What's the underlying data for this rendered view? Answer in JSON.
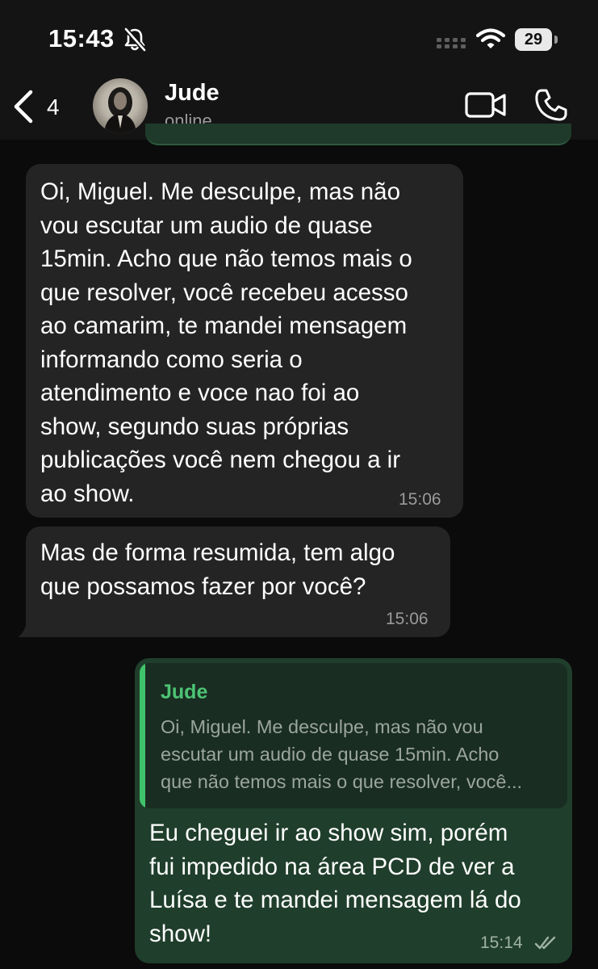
{
  "status_bar": {
    "time": "15:43",
    "battery": "29",
    "icons": [
      "bell-slash-icon",
      "signal-icon",
      "wifi-icon",
      "battery-icon"
    ]
  },
  "header": {
    "back_count": "4",
    "contact_name": "Jude",
    "contact_status": "online",
    "icons": [
      "chevron-left-icon",
      "video-camera-icon",
      "phone-icon"
    ]
  },
  "messages": [
    {
      "direction": "incoming",
      "text": "Oi, Miguel. Me desculpe, mas não\nvou escutar um audio de quase\n15min. Acho que não temos mais o\nque resolver, você recebeu acesso\nao camarim, te mandei mensagem\ninformando como seria o\natendimento e voce nao foi ao\nshow, segundo suas próprias\npublicações você nem chegou a ir\nao show.",
      "time": "15:06"
    },
    {
      "direction": "incoming",
      "text": "Mas de forma resumida, tem algo\nque possamos fazer por você?",
      "time": "15:06"
    },
    {
      "direction": "outgoing",
      "quote_author": "Jude",
      "quote_text": "Oi, Miguel. Me desculpe, mas não vou\nescutar um audio de quase 15min. Acho\nque não temos mais o que resolver, você...",
      "text": "Eu cheguei ir ao show sim, porém\nfui impedido na área PCD de ver a\nLuísa e te mandei mensagem lá do\nshow!",
      "time": "15:14",
      "status": "read"
    }
  ],
  "colors": {
    "background": "#0b0b0b",
    "incoming_bubble": "#242424",
    "outgoing_bubble": "#1f3e2b",
    "quote_accent": "#3fc36b"
  }
}
